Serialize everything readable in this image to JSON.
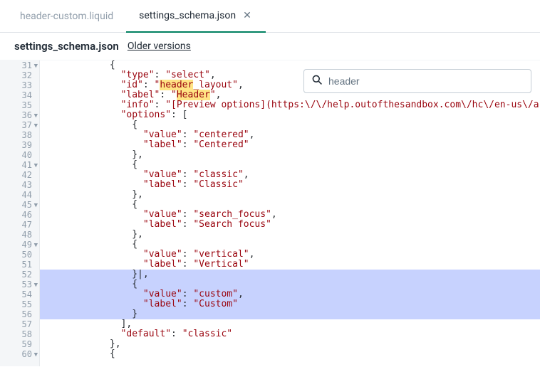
{
  "tabs": [
    {
      "label": "header-custom.liquid",
      "active": false
    },
    {
      "label": "settings_schema.json",
      "active": true
    }
  ],
  "file_header": {
    "title": "settings_schema.json",
    "older_versions": "Older versions"
  },
  "search": {
    "value": "header",
    "placeholder": "header"
  },
  "code_lines": [
    {
      "n": 31,
      "fold": true,
      "indent": 12,
      "tokens": [
        {
          "t": "{",
          "c": "punct"
        }
      ]
    },
    {
      "n": 32,
      "fold": false,
      "indent": 14,
      "tokens": [
        {
          "t": "\"type\"",
          "c": "key"
        },
        {
          "t": ": ",
          "c": "punct"
        },
        {
          "t": "\"select\"",
          "c": "string"
        },
        {
          "t": ",",
          "c": "punct"
        }
      ]
    },
    {
      "n": 33,
      "fold": false,
      "indent": 14,
      "tokens": [
        {
          "t": "\"id\"",
          "c": "key"
        },
        {
          "t": ": ",
          "c": "punct"
        },
        {
          "t": "\"",
          "c": "string"
        },
        {
          "t": "header",
          "c": "string",
          "hl": true
        },
        {
          "t": "_layout\"",
          "c": "string"
        },
        {
          "t": ",",
          "c": "punct"
        }
      ]
    },
    {
      "n": 34,
      "fold": false,
      "indent": 14,
      "tokens": [
        {
          "t": "\"label\"",
          "c": "key"
        },
        {
          "t": ": ",
          "c": "punct"
        },
        {
          "t": "\"",
          "c": "string"
        },
        {
          "t": "Header",
          "c": "string",
          "hl": true
        },
        {
          "t": "\"",
          "c": "string"
        },
        {
          "t": ",",
          "c": "punct"
        }
      ]
    },
    {
      "n": 35,
      "fold": false,
      "indent": 14,
      "tokens": [
        {
          "t": "\"info\"",
          "c": "key"
        },
        {
          "t": ": ",
          "c": "punct"
        },
        {
          "t": "\"[Preview options](https:\\/\\/help.outofthesandbox.com\\/hc\\/en-us\\/a",
          "c": "string"
        }
      ]
    },
    {
      "n": 36,
      "fold": true,
      "indent": 14,
      "tokens": [
        {
          "t": "\"options\"",
          "c": "key"
        },
        {
          "t": ": [",
          "c": "punct"
        }
      ]
    },
    {
      "n": 37,
      "fold": true,
      "indent": 16,
      "tokens": [
        {
          "t": "{",
          "c": "punct"
        }
      ]
    },
    {
      "n": 38,
      "fold": false,
      "indent": 18,
      "tokens": [
        {
          "t": "\"value\"",
          "c": "key"
        },
        {
          "t": ": ",
          "c": "punct"
        },
        {
          "t": "\"centered\"",
          "c": "string"
        },
        {
          "t": ",",
          "c": "punct"
        }
      ]
    },
    {
      "n": 39,
      "fold": false,
      "indent": 18,
      "tokens": [
        {
          "t": "\"label\"",
          "c": "key"
        },
        {
          "t": ": ",
          "c": "punct"
        },
        {
          "t": "\"Centered\"",
          "c": "string"
        }
      ]
    },
    {
      "n": 40,
      "fold": false,
      "indent": 16,
      "tokens": [
        {
          "t": "},",
          "c": "punct"
        }
      ]
    },
    {
      "n": 41,
      "fold": true,
      "indent": 16,
      "tokens": [
        {
          "t": "{",
          "c": "punct"
        }
      ]
    },
    {
      "n": 42,
      "fold": false,
      "indent": 18,
      "tokens": [
        {
          "t": "\"value\"",
          "c": "key"
        },
        {
          "t": ": ",
          "c": "punct"
        },
        {
          "t": "\"classic\"",
          "c": "string"
        },
        {
          "t": ",",
          "c": "punct"
        }
      ]
    },
    {
      "n": 43,
      "fold": false,
      "indent": 18,
      "tokens": [
        {
          "t": "\"label\"",
          "c": "key"
        },
        {
          "t": ": ",
          "c": "punct"
        },
        {
          "t": "\"Classic\"",
          "c": "string"
        }
      ]
    },
    {
      "n": 44,
      "fold": false,
      "indent": 16,
      "tokens": [
        {
          "t": "},",
          "c": "punct"
        }
      ]
    },
    {
      "n": 45,
      "fold": true,
      "indent": 16,
      "tokens": [
        {
          "t": "{",
          "c": "punct"
        }
      ]
    },
    {
      "n": 46,
      "fold": false,
      "indent": 18,
      "tokens": [
        {
          "t": "\"value\"",
          "c": "key"
        },
        {
          "t": ": ",
          "c": "punct"
        },
        {
          "t": "\"search_focus\"",
          "c": "string"
        },
        {
          "t": ",",
          "c": "punct"
        }
      ]
    },
    {
      "n": 47,
      "fold": false,
      "indent": 18,
      "tokens": [
        {
          "t": "\"label\"",
          "c": "key"
        },
        {
          "t": ": ",
          "c": "punct"
        },
        {
          "t": "\"Search focus\"",
          "c": "string"
        }
      ]
    },
    {
      "n": 48,
      "fold": false,
      "indent": 16,
      "tokens": [
        {
          "t": "},",
          "c": "punct"
        }
      ]
    },
    {
      "n": 49,
      "fold": true,
      "indent": 16,
      "tokens": [
        {
          "t": "{",
          "c": "punct"
        }
      ]
    },
    {
      "n": 50,
      "fold": false,
      "indent": 18,
      "tokens": [
        {
          "t": "\"value\"",
          "c": "key"
        },
        {
          "t": ": ",
          "c": "punct"
        },
        {
          "t": "\"vertical\"",
          "c": "string"
        },
        {
          "t": ",",
          "c": "punct"
        }
      ]
    },
    {
      "n": 51,
      "fold": false,
      "indent": 18,
      "tokens": [
        {
          "t": "\"label\"",
          "c": "key"
        },
        {
          "t": ": ",
          "c": "punct"
        },
        {
          "t": "\"Vertical\"",
          "c": "string"
        }
      ]
    },
    {
      "n": 52,
      "fold": false,
      "indent": 16,
      "tokens": [
        {
          "t": "}|,",
          "c": "punct"
        }
      ],
      "sel": true
    },
    {
      "n": 53,
      "fold": true,
      "indent": 16,
      "tokens": [
        {
          "t": "{",
          "c": "punct"
        }
      ],
      "sel": true
    },
    {
      "n": 54,
      "fold": false,
      "indent": 18,
      "tokens": [
        {
          "t": "\"value\"",
          "c": "key"
        },
        {
          "t": ": ",
          "c": "punct"
        },
        {
          "t": "\"custom\"",
          "c": "string"
        },
        {
          "t": ",",
          "c": "punct"
        }
      ],
      "sel": true
    },
    {
      "n": 55,
      "fold": false,
      "indent": 18,
      "tokens": [
        {
          "t": "\"label\"",
          "c": "key"
        },
        {
          "t": ": ",
          "c": "punct"
        },
        {
          "t": "\"Custom\"",
          "c": "string"
        }
      ],
      "sel": true
    },
    {
      "n": 56,
      "fold": false,
      "indent": 16,
      "tokens": [
        {
          "t": "}",
          "c": "punct"
        }
      ],
      "sel": true
    },
    {
      "n": 57,
      "fold": false,
      "indent": 14,
      "tokens": [
        {
          "t": "],",
          "c": "punct"
        }
      ]
    },
    {
      "n": 58,
      "fold": false,
      "indent": 14,
      "tokens": [
        {
          "t": "\"default\"",
          "c": "key"
        },
        {
          "t": ": ",
          "c": "punct"
        },
        {
          "t": "\"classic\"",
          "c": "string"
        }
      ]
    },
    {
      "n": 59,
      "fold": false,
      "indent": 12,
      "tokens": [
        {
          "t": "},",
          "c": "punct"
        }
      ]
    },
    {
      "n": 60,
      "fold": true,
      "indent": 12,
      "tokens": [
        {
          "t": "{",
          "c": "punct"
        }
      ]
    }
  ]
}
